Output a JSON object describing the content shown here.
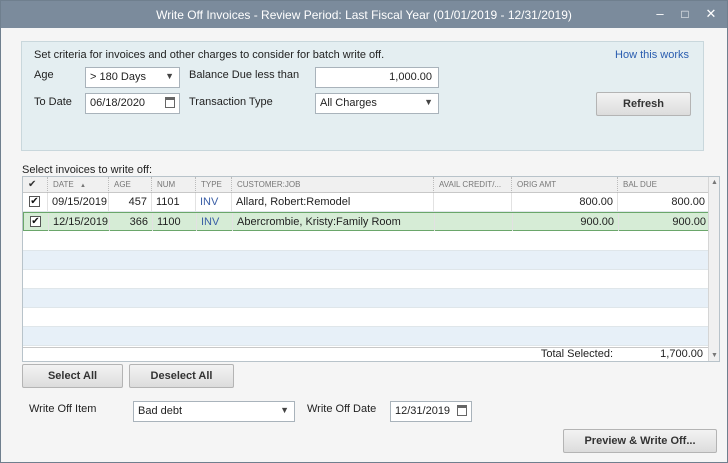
{
  "window": {
    "title": "Write Off Invoices - Review Period: Last Fiscal Year (01/01/2019 - 12/31/2019)",
    "min_glyph": "–",
    "max_glyph": "□",
    "close_glyph": "✕"
  },
  "criteria": {
    "heading": "Set criteria for invoices and other charges to consider for batch write off.",
    "help_link": "How this works",
    "age_label": "Age",
    "age_value": "> 180 Days",
    "to_date_label": "To Date",
    "to_date_value": "06/18/2020",
    "balance_label": "Balance Due less than",
    "balance_value": "1,000.00",
    "txn_type_label": "Transaction Type",
    "txn_type_value": "All Charges",
    "refresh_label": "Refresh"
  },
  "grid": {
    "label": "Select invoices to write off:",
    "headers": [
      "✔",
      "DATE",
      "AGE",
      "NUM",
      "TYPE",
      "CUSTOMER:JOB",
      "AVAIL CREDIT/...",
      "ORIG AMT",
      "BAL DUE"
    ],
    "sort_indicator": "▲",
    "rows": [
      {
        "checked": "✔",
        "date": "09/15/2019",
        "age": "457",
        "num": "1101",
        "type": "INV",
        "customer": "Allard, Robert:Remodel",
        "credit": "",
        "orig": "800.00",
        "bal": "800.00"
      },
      {
        "checked": "✔",
        "date": "12/15/2019",
        "age": "366",
        "num": "1100",
        "type": "INV",
        "customer": "Abercrombie, Kristy:Family Room",
        "credit": "",
        "orig": "900.00",
        "bal": "900.00"
      }
    ],
    "total_label": "Total Selected:",
    "total_value": "1,700.00"
  },
  "actions": {
    "select_all": "Select All",
    "deselect_all": "Deselect All",
    "write_off_item_label": "Write Off Item",
    "write_off_item_value": "Bad debt",
    "write_off_date_label": "Write Off Date",
    "write_off_date_value": "12/31/2019",
    "preview_label": "Preview & Write Off..."
  },
  "icons": {
    "dropdown": "chevron-down-icon",
    "calendar": "calendar-icon",
    "checkbox": "check-icon"
  },
  "colors": {
    "titlebar": "#7b8b9c",
    "criteria_bg": "#e4eef1",
    "selected_row": "#d6ecd6",
    "stripe": "#e7f0f8",
    "link": "#2a5db0"
  }
}
